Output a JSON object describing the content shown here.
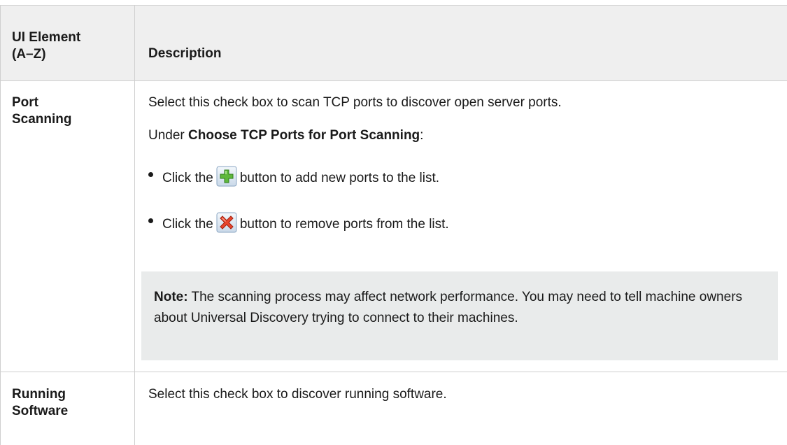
{
  "table": {
    "headers": {
      "element_line1": "UI Element",
      "element_line2": "(A–Z)",
      "description": "Description"
    },
    "rows": [
      {
        "name_line1": "Port",
        "name_line2": "Scanning",
        "description": "Select this check box to scan TCP ports to discover open server ports.",
        "under_prefix": "Under ",
        "under_bold": "Choose TCP Ports for Port Scanning",
        "under_suffix": ":",
        "bullets": [
          {
            "prefix": "Click the",
            "icon": "add-icon",
            "suffix": "button to add new ports to the list."
          },
          {
            "prefix": "Click the",
            "icon": "remove-icon",
            "suffix": "button to remove ports from the list."
          }
        ],
        "note": {
          "label": "Note:",
          "text": " The scanning process may affect network performance. You may need to tell machine owners about Universal Discovery trying to connect to their machines."
        }
      },
      {
        "name_line1": "Running",
        "name_line2": "Software",
        "description": "Select this check box to discover running software."
      }
    ]
  },
  "colors": {
    "header_bg": "#efefef",
    "note_bg": "#e9ebeb",
    "border": "#cfcfcf",
    "text": "#1a1a1a"
  }
}
